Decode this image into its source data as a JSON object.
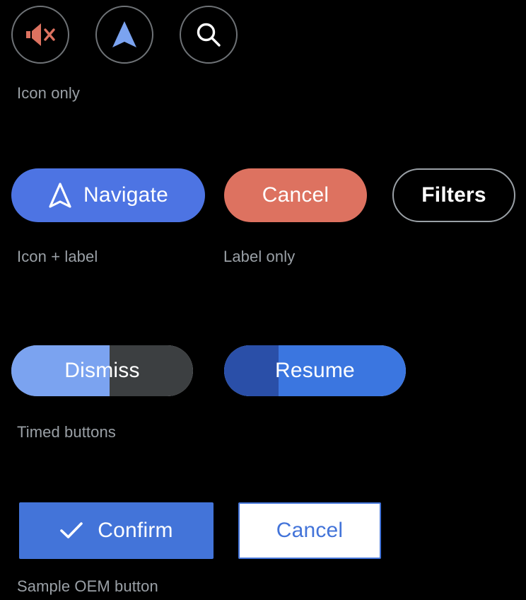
{
  "background_color": "#000000",
  "sections": [
    {
      "id": "icon-only",
      "caption": "Icon only",
      "buttons": [
        {
          "name": "mute-button",
          "icon": "volume-mute-icon",
          "icon_color": "#dd7260",
          "border_color": "#6e7276"
        },
        {
          "name": "navigate-button",
          "icon": "navigation-arrow-icon",
          "icon_color": "#7ba3f0",
          "border_color": "#6e7276"
        },
        {
          "name": "search-button",
          "icon": "search-icon",
          "icon_color": "#ffffff",
          "border_color": "#6e7276"
        }
      ]
    },
    {
      "id": "icon-plus-label",
      "caption": "Icon + label",
      "buttons": [
        {
          "name": "navigate-button",
          "label": "Navigate",
          "icon": "navigation-arrow-icon",
          "style": "filled",
          "background": "#4d74e3",
          "text_color": "#ffffff"
        }
      ]
    },
    {
      "id": "label-only",
      "caption": "Label only",
      "buttons": [
        {
          "name": "cancel-button",
          "label": "Cancel",
          "style": "filled",
          "background": "#dd7260",
          "text_color": "#ffffff"
        },
        {
          "name": "filters-button",
          "label": "Filters",
          "style": "outlined",
          "background": "#000000",
          "border_color": "#9aa0a6",
          "text_color": "#ffffff"
        }
      ]
    },
    {
      "id": "timed-buttons",
      "caption": "Timed buttons",
      "buttons": [
        {
          "name": "dismiss-button",
          "label": "Dismiss",
          "progress_percent": 54,
          "progress_color": "#7ba3f0",
          "track_color": "#3c3f41",
          "text_color": "#ffffff"
        },
        {
          "name": "resume-button",
          "label": "Resume",
          "progress_percent": 30,
          "progress_color": "#2a4fa8",
          "track_color": "#3b76e0",
          "text_color": "#ffffff"
        }
      ]
    },
    {
      "id": "oem-buttons",
      "caption": "Sample OEM button",
      "buttons": [
        {
          "name": "confirm-button",
          "label": "Confirm",
          "icon": "check-icon",
          "style": "filled",
          "background": "#4374d9",
          "text_color": "#ffffff"
        },
        {
          "name": "cancel-button",
          "label": "Cancel",
          "style": "outlined",
          "background": "#ffffff",
          "border_color": "#4374d9",
          "text_color": "#4374d9"
        }
      ]
    }
  ]
}
